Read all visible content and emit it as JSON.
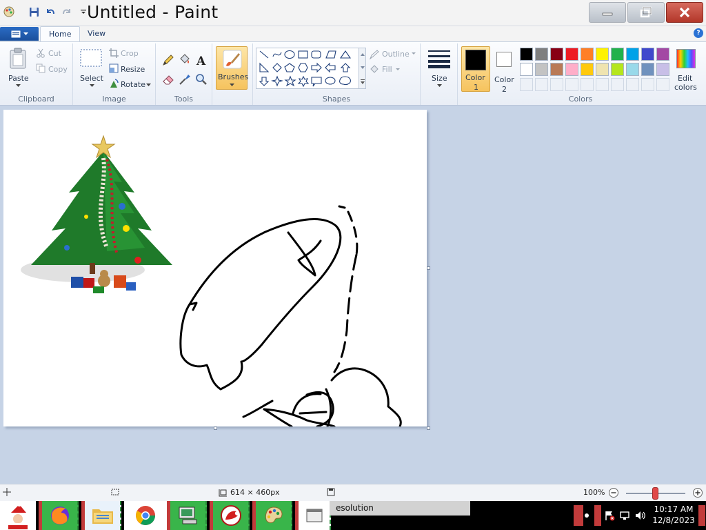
{
  "window": {
    "title": "Untitled - Paint"
  },
  "tabs": {
    "home": "Home",
    "view": "View"
  },
  "ribbon": {
    "clipboard": {
      "group_label": "Clipboard",
      "paste": "Paste",
      "cut": "Cut",
      "copy": "Copy"
    },
    "image": {
      "group_label": "Image",
      "select": "Select",
      "crop": "Crop",
      "resize": "Resize",
      "rotate": "Rotate"
    },
    "tools": {
      "group_label": "Tools"
    },
    "brushes": {
      "label": "Brushes"
    },
    "shapes": {
      "group_label": "Shapes",
      "outline": "Outline",
      "fill": "Fill"
    },
    "size": {
      "label": "Size"
    },
    "colors": {
      "group_label": "Colors",
      "color1": "Color",
      "color1_num": "1",
      "color2": "Color",
      "color2_num": "2",
      "edit_colors_1": "Edit",
      "edit_colors_2": "colors",
      "color1_value": "#000000",
      "color2_value": "#ffffff",
      "palette_row1": [
        "#000000",
        "#7f7f7f",
        "#880015",
        "#ed1c24",
        "#ff7f27",
        "#fff200",
        "#22b14c",
        "#00a2e8",
        "#3f48cc",
        "#a349a4"
      ],
      "palette_row2": [
        "#ffffff",
        "#c3c3c3",
        "#b97a57",
        "#ffaec9",
        "#ffc90e",
        "#efe4b0",
        "#b5e61d",
        "#99d9ea",
        "#7092be",
        "#c8bfe7"
      ]
    }
  },
  "statusbar": {
    "dimensions": "614 × 460px",
    "zoom": "100%",
    "zoom_level": 0.5
  },
  "taskbar": {
    "task_label": "esolution",
    "time": "10:17 AM",
    "date": "12/8/2023"
  }
}
